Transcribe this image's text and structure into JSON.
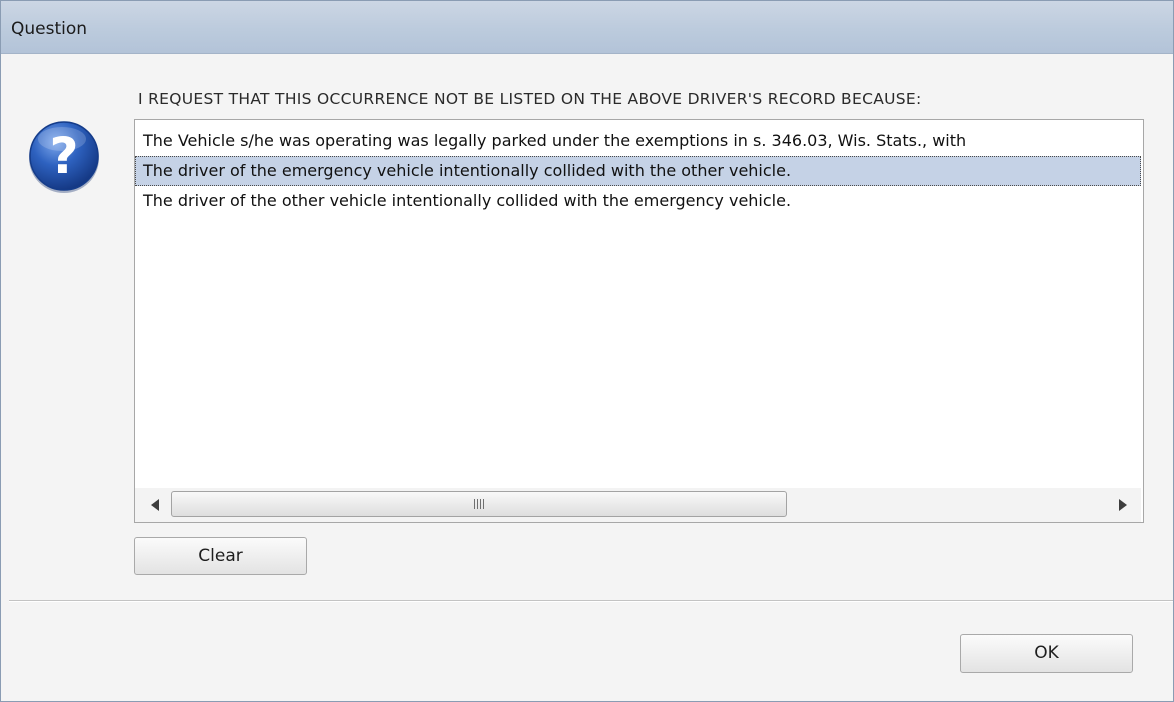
{
  "window": {
    "title": "Question"
  },
  "icon": "question-icon",
  "prompt": "I REQUEST THAT THIS OCCURRENCE NOT BE LISTED ON THE ABOVE DRIVER'S RECORD BECAUSE:",
  "list": {
    "items": [
      "The Vehicle s/he was operating was legally parked under the exemptions in s. 346.03, Wis. Stats., with",
      "The driver of the emergency vehicle intentionally collided with the other vehicle.",
      "The driver of the other vehicle intentionally collided with the emergency vehicle."
    ],
    "selected_index": 1
  },
  "buttons": {
    "clear_label": "Clear",
    "ok_label": "OK"
  },
  "colors": {
    "title_bar": "#bccbdd",
    "selection": "#c5d2e6",
    "icon_blue": "#1f4fa8"
  }
}
